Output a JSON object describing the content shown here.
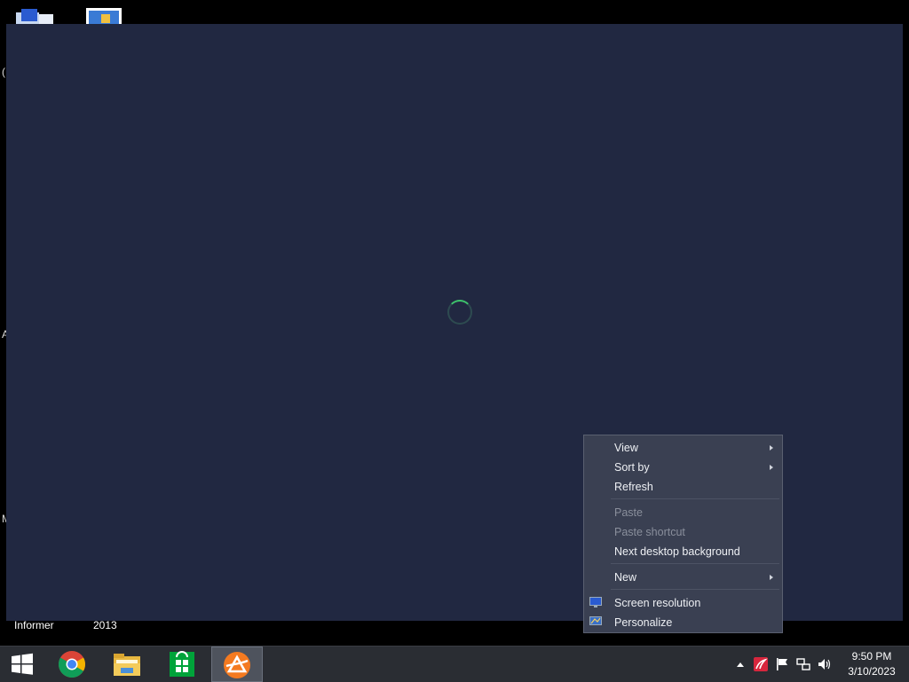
{
  "desktop": {
    "edge_chars": [
      "(",
      "A",
      "M"
    ],
    "labels": [
      "Informer",
      "2013"
    ]
  },
  "context_menu": {
    "items": [
      {
        "label": "View",
        "submenu": true,
        "disabled": false
      },
      {
        "label": "Sort by",
        "submenu": true,
        "disabled": false
      },
      {
        "label": "Refresh",
        "submenu": false,
        "disabled": false
      },
      {
        "label": "Paste",
        "submenu": false,
        "disabled": true
      },
      {
        "label": "Paste shortcut",
        "submenu": false,
        "disabled": true
      },
      {
        "label": "Next desktop background",
        "submenu": false,
        "disabled": false
      },
      {
        "label": "New",
        "submenu": true,
        "disabled": false
      },
      {
        "label": "Screen resolution",
        "submenu": false,
        "disabled": false,
        "icon": "monitor-icon"
      },
      {
        "label": "Personalize",
        "submenu": false,
        "disabled": false,
        "icon": "personalize-icon"
      }
    ]
  },
  "taskbar": {
    "apps": [
      "start-icon",
      "chrome-icon",
      "file-explorer-icon",
      "store-icon",
      "avast-icon"
    ],
    "tray_icons": [
      "show-hidden-icon",
      "antivirus-icon",
      "flag-icon",
      "network-icon",
      "volume-icon"
    ],
    "time": "9:50 PM",
    "date": "3/10/2023"
  },
  "colors": {
    "overlay": "#212841",
    "menu_bg": "#3a4052",
    "taskbar": "#2a2d33",
    "spinner": "#3ec36c"
  }
}
